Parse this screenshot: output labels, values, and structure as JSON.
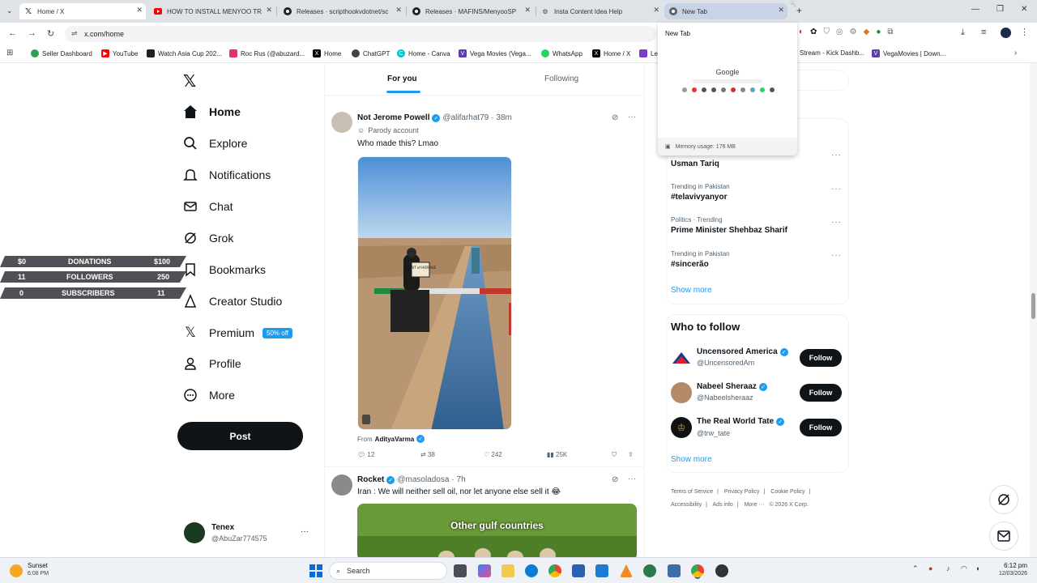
{
  "browser": {
    "tabs": [
      {
        "title": "Home / X",
        "icon": "x-logo-icon"
      },
      {
        "title": "HOW TO INSTALL MENYOO TR",
        "icon": "youtube-icon"
      },
      {
        "title": "Releases · scripthookvdotnet/sc",
        "icon": "github-icon"
      },
      {
        "title": "Releases · MAFINS/MenyooSP",
        "icon": "github-icon"
      },
      {
        "title": "Insta Content Idea Help",
        "icon": "chatgpt-icon"
      },
      {
        "title": "New Tab",
        "icon": "chrome-icon"
      }
    ],
    "address": "x.com/home",
    "bookmarks": [
      {
        "label": "Seller Dashboard",
        "color": "#2e9e4f"
      },
      {
        "label": "YouTube",
        "color": "#ff0000"
      },
      {
        "label": "Watch Asia Cup 202...",
        "color": "#222222"
      },
      {
        "label": "Roc Rus (@abuzard...",
        "color": "#e1306c"
      },
      {
        "label": "Home",
        "color": "#000000"
      },
      {
        "label": "ChatGPT",
        "color": "#444444"
      },
      {
        "label": "Home - Canva",
        "color": "#00c4cc"
      },
      {
        "label": "Vega Movies (Vega...",
        "color": "#5b3fa8"
      },
      {
        "label": "WhatsApp",
        "color": "#25d366"
      },
      {
        "label": "Home / X",
        "color": "#000000"
      },
      {
        "label": "Le",
        "color": "#7b3fc7"
      },
      {
        "label": "Stream - Kick Dashb...",
        "color": "#53fc18"
      },
      {
        "label": "VegaMovies | Down...",
        "color": "#5b3fa8"
      }
    ],
    "popup": {
      "title": "New Tab",
      "logo": "Google",
      "memory": "Memory usage: 176 MB"
    }
  },
  "overlay": {
    "rows": [
      {
        "left": "$0",
        "label": "DONATIONS",
        "right": "$100"
      },
      {
        "left": "11",
        "label": "FOLLOWERS",
        "right": "250"
      },
      {
        "left": "0",
        "label": "SUBSCRIBERS",
        "right": "11"
      }
    ]
  },
  "nav": {
    "items": [
      {
        "label": "Home",
        "icon": "home-icon"
      },
      {
        "label": "Explore",
        "icon": "search-icon"
      },
      {
        "label": "Notifications",
        "icon": "bell-icon"
      },
      {
        "label": "Chat",
        "icon": "mail-icon"
      },
      {
        "label": "Grok",
        "icon": "grok-icon"
      },
      {
        "label": "Bookmarks",
        "icon": "bookmark-icon"
      },
      {
        "label": "Creator Studio",
        "icon": "creator-icon"
      },
      {
        "label": "Premium",
        "icon": "x-logo-icon"
      },
      {
        "label": "Profile",
        "icon": "person-icon"
      },
      {
        "label": "More",
        "icon": "more-circle-icon"
      }
    ],
    "premium_badge": "50% off",
    "post": "Post",
    "account": {
      "name": "Tenex",
      "handle": "@AbuZar774575"
    }
  },
  "feed": {
    "tabs": {
      "for_you": "For you",
      "following": "Following"
    },
    "tweets": [
      {
        "name": "Not Jerome Powell",
        "handle": "@alifarhat79",
        "time": "· 38m",
        "tag": "Parody account",
        "text": "Who made this? Lmao",
        "media_sign": "STRAIT of HORMUZ",
        "from_label": "From",
        "from_user": "AdityaVarma",
        "stats": {
          "replies": "12",
          "reposts": "38",
          "likes": "242",
          "views": "25K"
        }
      },
      {
        "name": "Rocket",
        "handle": "@masoladosa",
        "time": "· 7h",
        "text": "Iran : We will neither sell oil, nor let anyone else sell it 😂",
        "media_caption": "Other gulf countries"
      }
    ]
  },
  "right": {
    "trends": [
      {
        "context": "",
        "title": "Usman Tariq"
      },
      {
        "context": "Trending in Pakistan",
        "title": "#telavivyanyor"
      },
      {
        "context": "Politics · Trending",
        "title": "Prime Minister Shehbaz Sharif"
      },
      {
        "context": "Trending in Pakistan",
        "title": "#sincerão"
      }
    ],
    "show_more": "Show more",
    "who_to_follow": {
      "title": "Who to follow",
      "users": [
        {
          "name": "Uncensored America",
          "handle": "@UncensoredAm"
        },
        {
          "name": "Nabeel Sheraaz",
          "handle": "@Nabeelsheraaz"
        },
        {
          "name": "The Real World Tate",
          "handle": "@trw_tate"
        }
      ],
      "follow": "Follow"
    },
    "footer": [
      "Terms of Service",
      "Privacy Policy",
      "Cookie Policy",
      "Accessibility",
      "Ads info",
      "More ···",
      "© 2026 X Corp."
    ]
  },
  "taskbar": {
    "weather": {
      "label": "Sunset",
      "time": "6:08 PM"
    },
    "search": "Search",
    "clock": {
      "time": "6:12 pm",
      "date": "12/03/2026"
    }
  }
}
